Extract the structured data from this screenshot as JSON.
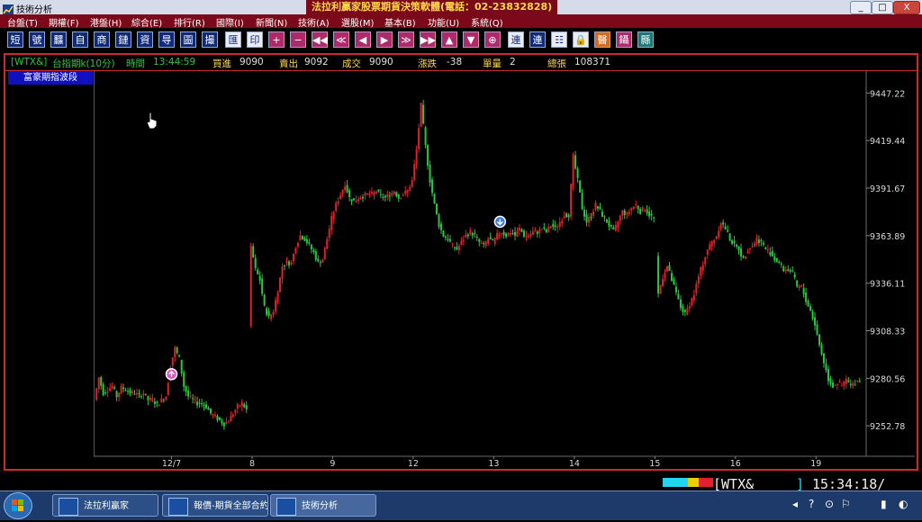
{
  "window": {
    "title": "技術分析",
    "banner": "法拉利贏家股票期貨決策軟體(電話：02-23832828)",
    "controls": {
      "minimize": "_",
      "maximize": "□",
      "close": "X"
    }
  },
  "menu": [
    "台盤(T)",
    "期權(F)",
    "港盤(H)",
    "綜合(E)",
    "排行(R)",
    "國際(I)",
    "新聞(N)",
    "技術(A)",
    "選股(M)",
    "基本(B)",
    "功能(U)",
    "系統(Q)"
  ],
  "toolbar": {
    "buttons": [
      "短",
      "號",
      "䨻",
      "自",
      "商",
      "鏈",
      "資",
      "㝵",
      "圖",
      "撮",
      "匯",
      "印",
      "+",
      "−",
      "◀◀",
      "≪",
      "◀",
      "▶",
      "≫",
      "▶▶",
      "▲",
      "▼",
      "⊕",
      "連",
      "連",
      "☷",
      "🔒",
      "醫",
      "鑷",
      "縣"
    ]
  },
  "quote": {
    "symbol": "[WTX&]",
    "name": "台指期k(10分)",
    "time_label": "時間",
    "time": "13:44:59",
    "bid_label": "買進",
    "bid": "9090",
    "ask_label": "賣出",
    "ask": "9092",
    "last_label": "成交",
    "last": "9090",
    "change_label": "漲跌",
    "change": "-38",
    "volume_label": "單量",
    "volume": "2",
    "total_label": "總張",
    "total": "108371"
  },
  "study_button": "富豪期指波段",
  "chart_data": {
    "type": "candlestick",
    "y_ticks": [
      9447.22,
      9419.44,
      9391.67,
      9363.89,
      9336.11,
      9308.33,
      9280.56,
      9252.78
    ],
    "ylim": [
      9235,
      9460
    ],
    "x_ticks": [
      "12/7",
      "8",
      "9",
      "12",
      "13",
      "14",
      "15",
      "16",
      "19"
    ],
    "colors": {
      "up": "#e0202a",
      "down": "#27c93f",
      "background": "#000000",
      "axis_text": "#d8d8d8"
    },
    "path": [
      [
        0,
        9268
      ],
      [
        5,
        9281
      ],
      [
        10,
        9272
      ],
      [
        15,
        9274
      ],
      [
        20,
        9276
      ],
      [
        25,
        9270
      ],
      [
        30,
        9275
      ],
      [
        35,
        9274
      ],
      [
        40,
        9272
      ],
      [
        45,
        9272
      ],
      [
        50,
        9270
      ],
      [
        55,
        9272
      ],
      [
        60,
        9268
      ],
      [
        65,
        9268
      ],
      [
        70,
        9265
      ],
      [
        75,
        9268
      ],
      [
        80,
        9270
      ],
      [
        85,
        9288
      ],
      [
        90,
        9298
      ],
      [
        95,
        9292
      ],
      [
        100,
        9276
      ],
      [
        105,
        9270
      ],
      [
        110,
        9268
      ],
      [
        115,
        9266
      ],
      [
        120,
        9266
      ],
      [
        125,
        9264
      ],
      [
        130,
        9260
      ],
      [
        135,
        9258
      ],
      [
        140,
        9256
      ],
      [
        145,
        9254
      ],
      [
        150,
        9256
      ],
      [
        155,
        9260
      ],
      [
        160,
        9264
      ],
      [
        165,
        9266
      ],
      [
        170,
        9262
      ],
      [
        175,
        9358
      ],
      [
        180,
        9344
      ],
      [
        185,
        9338
      ],
      [
        190,
        9322
      ],
      [
        195,
        9316
      ],
      [
        200,
        9320
      ],
      [
        205,
        9332
      ],
      [
        210,
        9346
      ],
      [
        215,
        9348
      ],
      [
        220,
        9348
      ],
      [
        225,
        9358
      ],
      [
        230,
        9364
      ],
      [
        235,
        9362
      ],
      [
        240,
        9358
      ],
      [
        245,
        9354
      ],
      [
        250,
        9348
      ],
      [
        255,
        9350
      ],
      [
        260,
        9362
      ],
      [
        265,
        9374
      ],
      [
        270,
        9382
      ],
      [
        275,
        9388
      ],
      [
        280,
        9394
      ],
      [
        285,
        9386
      ],
      [
        290,
        9384
      ],
      [
        295,
        9386
      ],
      [
        300,
        9387
      ],
      [
        305,
        9388
      ],
      [
        310,
        9388
      ],
      [
        315,
        9390
      ],
      [
        320,
        9387
      ],
      [
        325,
        9386
      ],
      [
        330,
        9388
      ],
      [
        335,
        9390
      ],
      [
        340,
        9386
      ],
      [
        345,
        9388
      ],
      [
        350,
        9390
      ],
      [
        355,
        9396
      ],
      [
        360,
        9414
      ],
      [
        365,
        9440
      ],
      [
        370,
        9416
      ],
      [
        375,
        9396
      ],
      [
        380,
        9382
      ],
      [
        385,
        9370
      ],
      [
        390,
        9364
      ],
      [
        395,
        9362
      ],
      [
        400,
        9358
      ],
      [
        405,
        9356
      ],
      [
        410,
        9360
      ],
      [
        415,
        9364
      ],
      [
        420,
        9366
      ],
      [
        425,
        9364
      ],
      [
        430,
        9360
      ],
      [
        435,
        9358
      ],
      [
        440,
        9362
      ],
      [
        445,
        9360
      ],
      [
        450,
        9364
      ],
      [
        455,
        9366
      ],
      [
        460,
        9364
      ],
      [
        465,
        9366
      ],
      [
        470,
        9364
      ],
      [
        475,
        9368
      ],
      [
        480,
        9364
      ],
      [
        485,
        9364
      ],
      [
        490,
        9366
      ],
      [
        495,
        9366
      ],
      [
        500,
        9368
      ],
      [
        505,
        9366
      ],
      [
        510,
        9370
      ],
      [
        515,
        9368
      ],
      [
        520,
        9372
      ],
      [
        525,
        9376
      ],
      [
        530,
        9376
      ],
      [
        535,
        9410
      ],
      [
        540,
        9396
      ],
      [
        545,
        9380
      ],
      [
        550,
        9372
      ],
      [
        555,
        9376
      ],
      [
        560,
        9382
      ],
      [
        565,
        9378
      ],
      [
        570,
        9374
      ],
      [
        575,
        9370
      ],
      [
        580,
        9366
      ],
      [
        585,
        9372
      ],
      [
        590,
        9378
      ],
      [
        595,
        9376
      ],
      [
        600,
        9380
      ],
      [
        605,
        9382
      ],
      [
        610,
        9378
      ],
      [
        615,
        9380
      ],
      [
        620,
        9376
      ],
      [
        625,
        9374
      ],
      [
        630,
        9330
      ],
      [
        635,
        9340
      ],
      [
        640,
        9346
      ],
      [
        645,
        9338
      ],
      [
        650,
        9330
      ],
      [
        655,
        9322
      ],
      [
        660,
        9318
      ],
      [
        665,
        9324
      ],
      [
        670,
        9330
      ],
      [
        675,
        9340
      ],
      [
        680,
        9348
      ],
      [
        685,
        9356
      ],
      [
        690,
        9360
      ],
      [
        695,
        9364
      ],
      [
        700,
        9372
      ],
      [
        705,
        9368
      ],
      [
        710,
        9362
      ],
      [
        715,
        9358
      ],
      [
        720,
        9356
      ],
      [
        725,
        9350
      ],
      [
        730,
        9356
      ],
      [
        735,
        9358
      ],
      [
        740,
        9362
      ],
      [
        745,
        9360
      ],
      [
        750,
        9356
      ],
      [
        755,
        9354
      ],
      [
        760,
        9350
      ],
      [
        765,
        9348
      ],
      [
        770,
        9344
      ],
      [
        775,
        9344
      ],
      [
        780,
        9342
      ],
      [
        785,
        9334
      ],
      [
        790,
        9334
      ],
      [
        795,
        9326
      ],
      [
        800,
        9320
      ],
      [
        805,
        9312
      ],
      [
        810,
        9300
      ],
      [
        815,
        9290
      ],
      [
        820,
        9280
      ],
      [
        825,
        9276
      ],
      [
        830,
        9278
      ],
      [
        835,
        9276
      ],
      [
        840,
        9280
      ],
      [
        845,
        9276
      ],
      [
        850,
        9278
      ],
      [
        855,
        9280
      ]
    ],
    "markers": [
      {
        "type": "buy",
        "x": 85,
        "price": 9283
      },
      {
        "type": "sell",
        "x": 452,
        "price": 9372
      }
    ]
  },
  "ticker": {
    "symbol": "[WTX&",
    "bracket": "]",
    "time": "15:34:18/"
  },
  "taskbar": {
    "tasks": [
      "法拉利贏家",
      "報價-期貨全部合約",
      "技術分析"
    ],
    "tray": [
      "◂",
      "?",
      "⊙",
      "⚐",
      "▮",
      "◐"
    ]
  }
}
